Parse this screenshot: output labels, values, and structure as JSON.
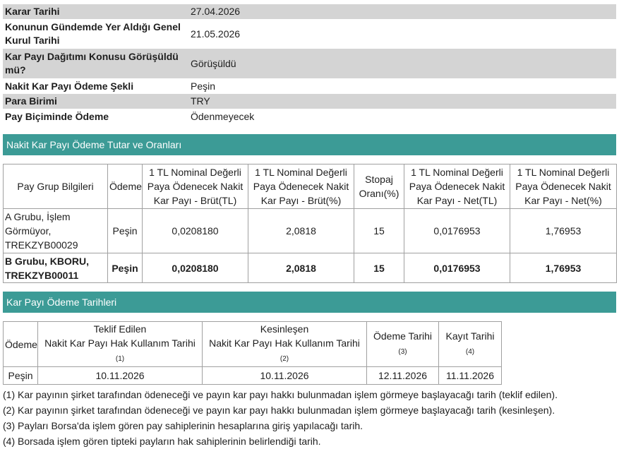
{
  "info_rows": [
    {
      "label": "Karar Tarihi",
      "value": "27.04.2026"
    },
    {
      "label": "Konunun Gündemde Yer Aldığı Genel Kurul Tarihi",
      "value": "21.05.2026"
    },
    {
      "label": "Kar Payı Dağıtımı Konusu Görüşüldü mü?",
      "value": "Görüşüldü"
    },
    {
      "label": "Nakit Kar Payı Ödeme Şekli",
      "value": "Peşin"
    },
    {
      "label": "Para Birimi",
      "value": "TRY"
    },
    {
      "label": "Pay Biçiminde Ödeme",
      "value": "Ödenmeyecek"
    }
  ],
  "section1_title": "Nakit Kar Payı Ödeme Tutar ve Oranları",
  "amounts_table": {
    "headers": [
      "Pay Grup Bilgileri",
      "Ödeme",
      "1 TL Nominal Değerli Paya Ödenecek Nakit Kar Payı - Brüt(TL)",
      "1 TL Nominal Değerli Paya Ödenecek Nakit Kar Payı - Brüt(%)",
      "Stopaj Oranı(%)",
      "1 TL Nominal Değerli Paya Ödenecek Nakit Kar Payı - Net(TL)",
      "1 TL Nominal Değerli Paya Ödenecek Nakit Kar Payı - Net(%)"
    ],
    "rows": [
      [
        "A Grubu, İşlem Görmüyor, TREKZYB00029",
        "Peşin",
        "0,0208180",
        "2,0818",
        "15",
        "0,0176953",
        "1,76953"
      ],
      [
        "B Grubu, KBORU, TREKZYB00011",
        "Peşin",
        "0,0208180",
        "2,0818",
        "15",
        "0,0176953",
        "1,76953"
      ]
    ]
  },
  "section2_title": "Kar Payı Ödeme Tarihleri",
  "dates_table": {
    "h_odeme": "Ödeme",
    "h_teklif_top": "Teklif Edilen",
    "h_teklif_bottom": "Nakit Kar Payı Hak Kullanım Tarihi",
    "h_teklif_note": "(1)",
    "h_kesin_top": "Kesinleşen",
    "h_kesin_bottom": "Nakit Kar Payı Hak Kullanım Tarihi",
    "h_kesin_note": "(2)",
    "h_odeme_tarihi": "Ödeme Tarihi",
    "h_odeme_tarihi_note": "(3)",
    "h_kayit": "Kayıt Tarihi",
    "h_kayit_note": "(4)",
    "row": [
      "Peşin",
      "10.11.2026",
      "10.11.2026",
      "12.11.2026",
      "11.11.2026"
    ]
  },
  "notes": [
    "(1) Kar payının şirket tarafından ödeneceği ve payın kar payı hakkı bulunmadan işlem görmeye başlayacağı tarih (teklif edilen).",
    "(2) Kar payının şirket tarafından ödeneceği ve payın kar payı hakkı bulunmadan işlem görmeye başlayacağı tarih (kesinleşen).",
    "(3) Payları Borsa'da işlem gören pay sahiplerinin hesaplarına giriş yapılacağı tarih.",
    "(4) Borsada işlem gören tipteki payların hak sahiplerinin belirlendiği tarih."
  ]
}
